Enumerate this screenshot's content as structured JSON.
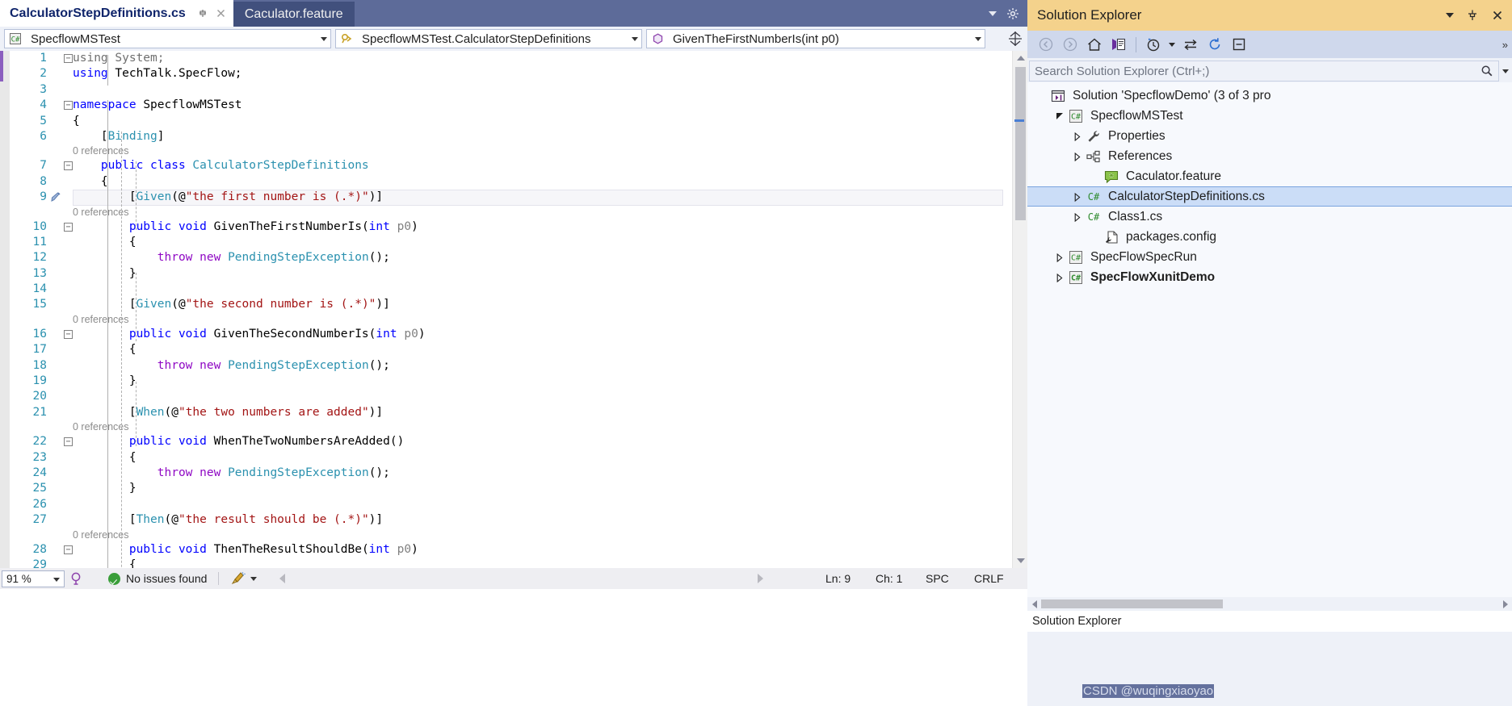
{
  "editor": {
    "tabs": [
      {
        "label": "CalculatorStepDefinitions.cs",
        "active": true,
        "icon": "csharp-file-icon"
      },
      {
        "label": "Caculator.feature",
        "active": false,
        "icon": "feature-file-icon"
      }
    ],
    "nav": {
      "project": "SpecflowMSTest",
      "project_icon": "csharp-project-icon",
      "type": "SpecflowMSTest.CalculatorStepDefinitions",
      "type_icon": "class-icon",
      "member": "GivenTheFirstNumberIs(int p0)",
      "member_icon": "method-icon",
      "split_icon": "split-window-icon"
    },
    "references_label": "0 references",
    "lines": [
      {
        "n": "1",
        "fold": "-",
        "tokens": [
          {
            "t": "using ",
            "c": "ns"
          },
          {
            "t": "System;",
            "c": "ns"
          }
        ]
      },
      {
        "n": "2",
        "fold": "",
        "tokens": [
          {
            "t": "using ",
            "c": "kw"
          },
          {
            "t": "TechTalk.SpecFlow;",
            "c": "plain"
          }
        ]
      },
      {
        "n": "3",
        "fold": "",
        "tokens": []
      },
      {
        "n": "4",
        "fold": "-",
        "tokens": [
          {
            "t": "namespace ",
            "c": "kw"
          },
          {
            "t": "SpecflowMSTest",
            "c": "plain"
          }
        ]
      },
      {
        "n": "5",
        "fold": "",
        "tokens": [
          {
            "t": "{",
            "c": "plain"
          }
        ]
      },
      {
        "n": "6",
        "fold": "",
        "tokens": [
          {
            "t": "    [",
            "c": "plain"
          },
          {
            "t": "Binding",
            "c": "type"
          },
          {
            "t": "]",
            "c": "plain"
          }
        ]
      },
      {
        "n": "7",
        "fold": "-",
        "ref": true,
        "tokens": [
          {
            "t": "    ",
            "c": "plain"
          },
          {
            "t": "public class ",
            "c": "kw"
          },
          {
            "t": "CalculatorStepDefinitions",
            "c": "type"
          }
        ]
      },
      {
        "n": "8",
        "fold": "",
        "tokens": [
          {
            "t": "    {",
            "c": "plain"
          }
        ]
      },
      {
        "n": "9",
        "fold": "",
        "current": true,
        "gutter": "screwdriver-icon",
        "tokens": [
          {
            "t": "        [",
            "c": "plain"
          },
          {
            "t": "Given",
            "c": "type"
          },
          {
            "t": "(@",
            "c": "plain"
          },
          {
            "t": "\"the first number is (.*)\"",
            "c": "str"
          },
          {
            "t": ")]",
            "c": "plain"
          }
        ]
      },
      {
        "n": "10",
        "fold": "-",
        "ref": true,
        "tokens": [
          {
            "t": "        ",
            "c": "plain"
          },
          {
            "t": "public void ",
            "c": "kw"
          },
          {
            "t": "GivenTheFirstNumberIs",
            "c": "plain"
          },
          {
            "t": "(",
            "c": "plain"
          },
          {
            "t": "int",
            "c": "kw"
          },
          {
            "t": " ",
            "c": "plain"
          },
          {
            "t": "p0",
            "c": "param"
          },
          {
            "t": ")",
            "c": "plain"
          }
        ]
      },
      {
        "n": "11",
        "fold": "",
        "tokens": [
          {
            "t": "        {",
            "c": "plain"
          }
        ]
      },
      {
        "n": "12",
        "fold": "",
        "tokens": [
          {
            "t": "            ",
            "c": "plain"
          },
          {
            "t": "throw new ",
            "c": "kw2"
          },
          {
            "t": "PendingStepException",
            "c": "type"
          },
          {
            "t": "();",
            "c": "plain"
          }
        ]
      },
      {
        "n": "13",
        "fold": "",
        "tokens": [
          {
            "t": "        }",
            "c": "plain"
          }
        ]
      },
      {
        "n": "14",
        "fold": "",
        "tokens": []
      },
      {
        "n": "15",
        "fold": "",
        "tokens": [
          {
            "t": "        [",
            "c": "plain"
          },
          {
            "t": "Given",
            "c": "type"
          },
          {
            "t": "(@",
            "c": "plain"
          },
          {
            "t": "\"the second number is (.*)\"",
            "c": "str"
          },
          {
            "t": ")]",
            "c": "plain"
          }
        ]
      },
      {
        "n": "16",
        "fold": "-",
        "ref": true,
        "tokens": [
          {
            "t": "        ",
            "c": "plain"
          },
          {
            "t": "public void ",
            "c": "kw"
          },
          {
            "t": "GivenTheSecondNumberIs",
            "c": "plain"
          },
          {
            "t": "(",
            "c": "plain"
          },
          {
            "t": "int",
            "c": "kw"
          },
          {
            "t": " ",
            "c": "plain"
          },
          {
            "t": "p0",
            "c": "param"
          },
          {
            "t": ")",
            "c": "plain"
          }
        ]
      },
      {
        "n": "17",
        "fold": "",
        "tokens": [
          {
            "t": "        {",
            "c": "plain"
          }
        ]
      },
      {
        "n": "18",
        "fold": "",
        "tokens": [
          {
            "t": "            ",
            "c": "plain"
          },
          {
            "t": "throw new ",
            "c": "kw2"
          },
          {
            "t": "PendingStepException",
            "c": "type"
          },
          {
            "t": "();",
            "c": "plain"
          }
        ]
      },
      {
        "n": "19",
        "fold": "",
        "tokens": [
          {
            "t": "        }",
            "c": "plain"
          }
        ]
      },
      {
        "n": "20",
        "fold": "",
        "tokens": []
      },
      {
        "n": "21",
        "fold": "",
        "tokens": [
          {
            "t": "        [",
            "c": "plain"
          },
          {
            "t": "When",
            "c": "type"
          },
          {
            "t": "(@",
            "c": "plain"
          },
          {
            "t": "\"the two numbers are added\"",
            "c": "str"
          },
          {
            "t": ")]",
            "c": "plain"
          }
        ]
      },
      {
        "n": "22",
        "fold": "-",
        "ref": true,
        "tokens": [
          {
            "t": "        ",
            "c": "plain"
          },
          {
            "t": "public void ",
            "c": "kw"
          },
          {
            "t": "WhenTheTwoNumbersAreAdded",
            "c": "plain"
          },
          {
            "t": "()",
            "c": "plain"
          }
        ]
      },
      {
        "n": "23",
        "fold": "",
        "tokens": [
          {
            "t": "        {",
            "c": "plain"
          }
        ]
      },
      {
        "n": "24",
        "fold": "",
        "tokens": [
          {
            "t": "            ",
            "c": "plain"
          },
          {
            "t": "throw new ",
            "c": "kw2"
          },
          {
            "t": "PendingStepException",
            "c": "type"
          },
          {
            "t": "();",
            "c": "plain"
          }
        ]
      },
      {
        "n": "25",
        "fold": "",
        "tokens": [
          {
            "t": "        }",
            "c": "plain"
          }
        ]
      },
      {
        "n": "26",
        "fold": "",
        "tokens": []
      },
      {
        "n": "27",
        "fold": "",
        "tokens": [
          {
            "t": "        [",
            "c": "plain"
          },
          {
            "t": "Then",
            "c": "type"
          },
          {
            "t": "(@",
            "c": "plain"
          },
          {
            "t": "\"the result should be (.*)\"",
            "c": "str"
          },
          {
            "t": ")]",
            "c": "plain"
          }
        ]
      },
      {
        "n": "28",
        "fold": "-",
        "ref": true,
        "tokens": [
          {
            "t": "        ",
            "c": "plain"
          },
          {
            "t": "public void ",
            "c": "kw"
          },
          {
            "t": "ThenTheResultShouldBe",
            "c": "plain"
          },
          {
            "t": "(",
            "c": "plain"
          },
          {
            "t": "int",
            "c": "kw"
          },
          {
            "t": " ",
            "c": "plain"
          },
          {
            "t": "p0",
            "c": "param"
          },
          {
            "t": ")",
            "c": "plain"
          }
        ]
      },
      {
        "n": "29",
        "fold": "",
        "tokens": [
          {
            "t": "        {",
            "c": "plain"
          }
        ]
      }
    ]
  },
  "statusbar": {
    "zoom": "91 %",
    "issues": "No issues found",
    "ln": "Ln: 9",
    "ch": "Ch: 1",
    "spaces": "SPC",
    "eol": "CRLF"
  },
  "solution_explorer": {
    "title": "Solution Explorer",
    "search_placeholder": "Search Solution Explorer (Ctrl+;)",
    "footer_label": "Solution Explorer",
    "toolbar": [
      {
        "name": "back-icon"
      },
      {
        "name": "forward-icon"
      },
      {
        "name": "home-icon"
      },
      {
        "name": "sync-with-active-document-icon"
      },
      {
        "name": "pending-changes-icon"
      },
      {
        "name": "preview-selected-items-icon"
      },
      {
        "name": "refresh-icon"
      },
      {
        "name": "collapse-all-icon"
      }
    ],
    "tree": [
      {
        "label": "Solution 'SpecflowDemo' (3 of 3 pro",
        "indent": 0,
        "expander": "none",
        "icon": "solution-icon",
        "bold": false,
        "selected": false
      },
      {
        "label": "SpecflowMSTest",
        "indent": 1,
        "expander": "down",
        "icon": "csharp-project-icon",
        "bold": false,
        "selected": false
      },
      {
        "label": "Properties",
        "indent": 2,
        "expander": "right",
        "icon": "wrench-icon",
        "bold": false,
        "selected": false
      },
      {
        "label": "References",
        "indent": 2,
        "expander": "right",
        "icon": "references-icon",
        "bold": false,
        "selected": false
      },
      {
        "label": "Caculator.feature",
        "indent": 3,
        "expander": "none",
        "icon": "feature-file-icon",
        "bold": false,
        "selected": false
      },
      {
        "label": "CalculatorStepDefinitions.cs",
        "indent": 2,
        "expander": "right",
        "icon": "csharp-file-icon",
        "bold": false,
        "selected": true
      },
      {
        "label": "Class1.cs",
        "indent": 2,
        "expander": "right",
        "icon": "csharp-file-icon",
        "bold": false,
        "selected": false
      },
      {
        "label": "packages.config",
        "indent": 3,
        "expander": "none",
        "icon": "config-file-icon",
        "bold": false,
        "selected": false
      },
      {
        "label": "SpecFlowSpecRun",
        "indent": 1,
        "expander": "right",
        "icon": "csharp-project-icon",
        "bold": false,
        "selected": false
      },
      {
        "label": "SpecFlowXunitDemo",
        "indent": 1,
        "expander": "right",
        "icon": "csharp-project-icon",
        "bold": true,
        "selected": false
      }
    ]
  },
  "watermark": {
    "text": "CSDN @wuqingxiaoyao"
  },
  "colors": {
    "chrome": "#5d6b99",
    "se_header": "#f4d28c",
    "selection": "#cbddf7",
    "keyword": "#0000ff",
    "type": "#2b91af",
    "string": "#a31515",
    "control_keyword": "#8f08c4",
    "line_number": "#2b91af"
  }
}
